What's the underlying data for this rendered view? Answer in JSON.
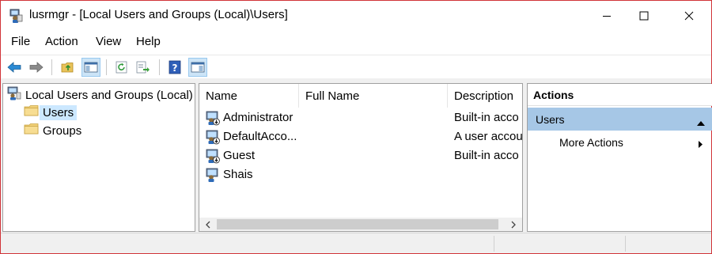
{
  "window": {
    "title": "lusrmgr - [Local Users and Groups (Local)\\Users]",
    "app_icon": "computer-management-icon",
    "controls": [
      "minimize-icon",
      "maximize-icon",
      "close-icon"
    ],
    "border_color": "#d13438"
  },
  "menu": {
    "items": [
      {
        "label": "File"
      },
      {
        "label": "Action"
      },
      {
        "label": "View"
      },
      {
        "label": "Help"
      }
    ]
  },
  "toolbar": {
    "buttons": [
      "back-arrow-icon",
      "forward-arrow-icon",
      "up-folder-icon",
      "show-hide-console-tree-icon",
      "refresh-icon",
      "export-list-icon",
      "help-icon",
      "show-hide-action-pane-icon"
    ]
  },
  "tree": {
    "root": {
      "label": "Local Users and Groups (Local)"
    },
    "children": [
      {
        "label": "Users",
        "selected": true
      },
      {
        "label": "Groups",
        "selected": false
      }
    ]
  },
  "list": {
    "columns": [
      {
        "label": "Name"
      },
      {
        "label": "Full Name"
      },
      {
        "label": "Description"
      }
    ],
    "rows": [
      {
        "name": "Administrator",
        "full_name": "",
        "description": "Built-in acco"
      },
      {
        "name": "DefaultAcco...",
        "full_name": "",
        "description": "A user accou"
      },
      {
        "name": "Guest",
        "full_name": "",
        "description": "Built-in acco"
      },
      {
        "name": "Shais",
        "full_name": "",
        "description": ""
      }
    ]
  },
  "actions": {
    "header": "Actions",
    "group_label": "Users",
    "items": [
      {
        "label": "More Actions"
      }
    ],
    "group_color": "#a6c7e6"
  },
  "colors": {
    "selection": "#cce8ff",
    "pressed_button": "#cce4f7"
  }
}
